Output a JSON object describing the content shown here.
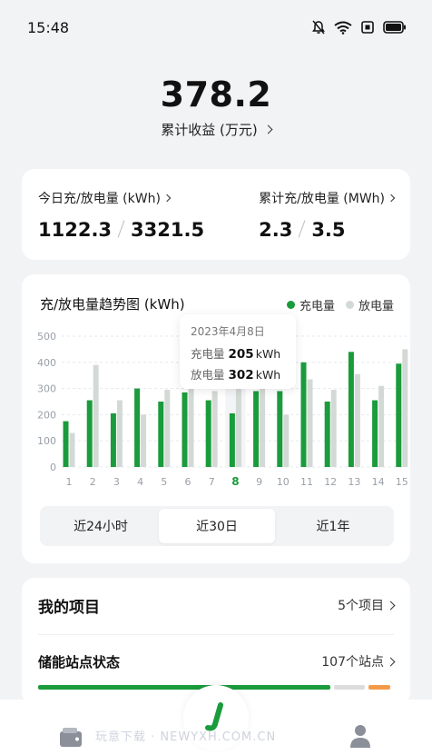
{
  "status": {
    "time": "15:48",
    "icons": [
      "bell-off-icon",
      "wifi-icon",
      "sim-icon",
      "battery-icon"
    ]
  },
  "hero": {
    "value": "378.2",
    "label": "累计收益 (万元)"
  },
  "summary": {
    "today": {
      "title": "今日充/放电量 (kWh)",
      "charge": "1122.3",
      "discharge": "3321.5"
    },
    "total": {
      "title": "累计充/放电量 (MWh)",
      "charge": "2.3",
      "discharge": "3.5"
    }
  },
  "chart": {
    "title": "充/放电量趋势图 (kWh)",
    "legend": {
      "charge": "充电量",
      "discharge": "放电量"
    },
    "tooltip": {
      "date": "2023年4月8日",
      "charge_label": "充电量",
      "charge_value": "205",
      "discharge_label": "放电量",
      "discharge_value": "302",
      "unit": "kWh"
    },
    "colors": {
      "charge": "#1a9b3c",
      "discharge": "#d3d9d5",
      "selected_label": "#1a9b3c"
    }
  },
  "chart_data": {
    "type": "bar",
    "categories": [
      "1",
      "2",
      "3",
      "4",
      "5",
      "6",
      "7",
      "8",
      "9",
      "10",
      "11",
      "12",
      "13",
      "14",
      "15"
    ],
    "series": [
      {
        "name": "充电量",
        "values": [
          175,
          255,
          205,
          300,
          250,
          285,
          255,
          205,
          290,
          290,
          400,
          250,
          440,
          255,
          395
        ]
      },
      {
        "name": "放电量",
        "values": [
          130,
          390,
          255,
          200,
          295,
          300,
          290,
          302,
          300,
          200,
          335,
          295,
          355,
          310,
          450
        ]
      }
    ],
    "yticks": [
      0,
      100,
      200,
      300,
      400,
      500
    ],
    "ylim": [
      0,
      500
    ],
    "selected_index": 7
  },
  "range_tabs": {
    "items": [
      "近24小时",
      "近30日",
      "近1年"
    ],
    "active": 1
  },
  "projects": {
    "title": "我的项目",
    "count": "5个项目"
  },
  "stations": {
    "title": "储能站点状态",
    "count": "107个站点"
  },
  "progress_colors": [
    "#1a9b3c",
    "#dcdcdc",
    "#f39a4a"
  ],
  "watermark": "玩意下载 · NEWYXH.COM.CN"
}
